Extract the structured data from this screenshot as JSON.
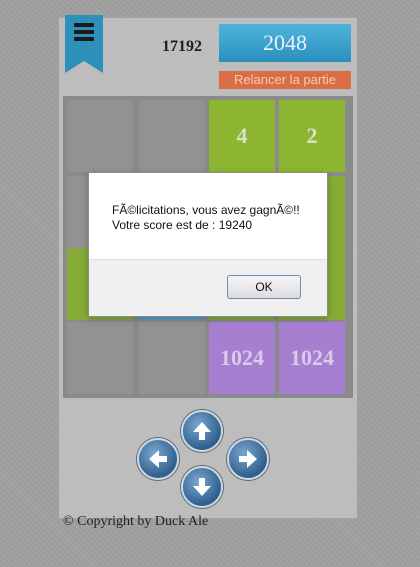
{
  "header": {
    "menu_icon": "menu-icon",
    "score": "17192",
    "best_tile": "2048",
    "restart_label": "Relancer la partie"
  },
  "board": {
    "tiles": {
      "r0c2": "4",
      "r0c3": "2",
      "r3c2": "1024",
      "r3c3": "1024"
    }
  },
  "controls": {
    "up": "arrow-up-icon",
    "left": "arrow-left-icon",
    "right": "arrow-right-icon",
    "down": "arrow-down-icon"
  },
  "footer": {
    "copyright": "© Copyright by Duck Ale"
  },
  "dialog": {
    "line1": "FÃ©licitations, vous avez gagnÃ©!!",
    "line2": "Votre score est de : 19240",
    "ok_label": "OK"
  },
  "colors": {
    "accent_blue": "#2e8fb8",
    "restart_orange": "#d96e45",
    "tile_green": "#8db532",
    "tile_purple": "#a77fd0"
  }
}
